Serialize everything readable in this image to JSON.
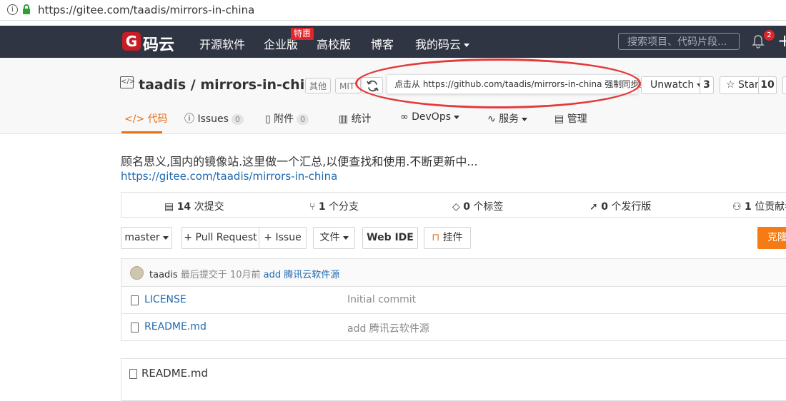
{
  "browser": {
    "url": "https://gitee.com/taadis/mirrors-in-china"
  },
  "nav": {
    "logo_letter": "G",
    "logo_text": "码云",
    "items": [
      "开源软件",
      "企业版",
      "高校版",
      "博客",
      "我的码云"
    ],
    "sale_badge": "特惠",
    "search_placeholder": "搜索项目、代码片段...",
    "notification_count": "2"
  },
  "repo": {
    "icon_text": "</>",
    "title": "taadis / mirrors-in-china",
    "tags": [
      "其他",
      "MIT"
    ],
    "tooltip": "点击从 https://github.com/taadis/mirrors-in-china 强制同步。",
    "watch_label": "Unwatch",
    "watch_count": "3",
    "star_label": "Star",
    "star_count": "10"
  },
  "tabs": [
    {
      "label": "代码",
      "icon": "code-icon"
    },
    {
      "label": "Issues",
      "count": "0",
      "icon": "issue-icon"
    },
    {
      "label": "附件",
      "count": "0",
      "icon": "attachment-icon"
    },
    {
      "label": "统计",
      "icon": "chart-icon"
    },
    {
      "label": "DevOps",
      "icon": "infinity-icon"
    },
    {
      "label": "服务",
      "icon": "pulse-icon"
    },
    {
      "label": "管理",
      "icon": "manage-icon"
    }
  ],
  "description": "顾名思义,国内的镜像站.这里做一个汇总,以便查找和使用.不断更新中...",
  "homepage": "https://gitee.com/taadis/mirrors-in-china",
  "stats": [
    {
      "count": "14",
      "label": "次提交",
      "icon": "commit-icon"
    },
    {
      "count": "1",
      "label": "个分支",
      "icon": "branch-icon"
    },
    {
      "count": "0",
      "label": "个标签",
      "icon": "tag-icon"
    },
    {
      "count": "0",
      "label": "个发行版",
      "icon": "release-icon"
    },
    {
      "count": "1",
      "label": "位贡献者",
      "icon": "contributor-icon"
    }
  ],
  "toolbar": {
    "branch": "master",
    "pull_request": "+ Pull Request",
    "issue": "+ Issue",
    "file": "文件",
    "web_ide": "Web IDE",
    "widget": "挂件",
    "clone": "克隆"
  },
  "commit": {
    "author": "taadis",
    "meta": "最后提交于 10月前",
    "message": "add 腾讯云软件源"
  },
  "files": [
    {
      "name": "LICENSE",
      "message": "Initial commit"
    },
    {
      "name": "README.md",
      "message": "add 腾讯云软件源"
    }
  ],
  "readme": {
    "title": "README.md"
  },
  "colors": {
    "nav_bg": "#2f3542",
    "brand_red": "#c71d23",
    "accent_orange": "#e8711c",
    "link_blue": "#1f6ab0",
    "annotation_red": "#e33a3a"
  }
}
